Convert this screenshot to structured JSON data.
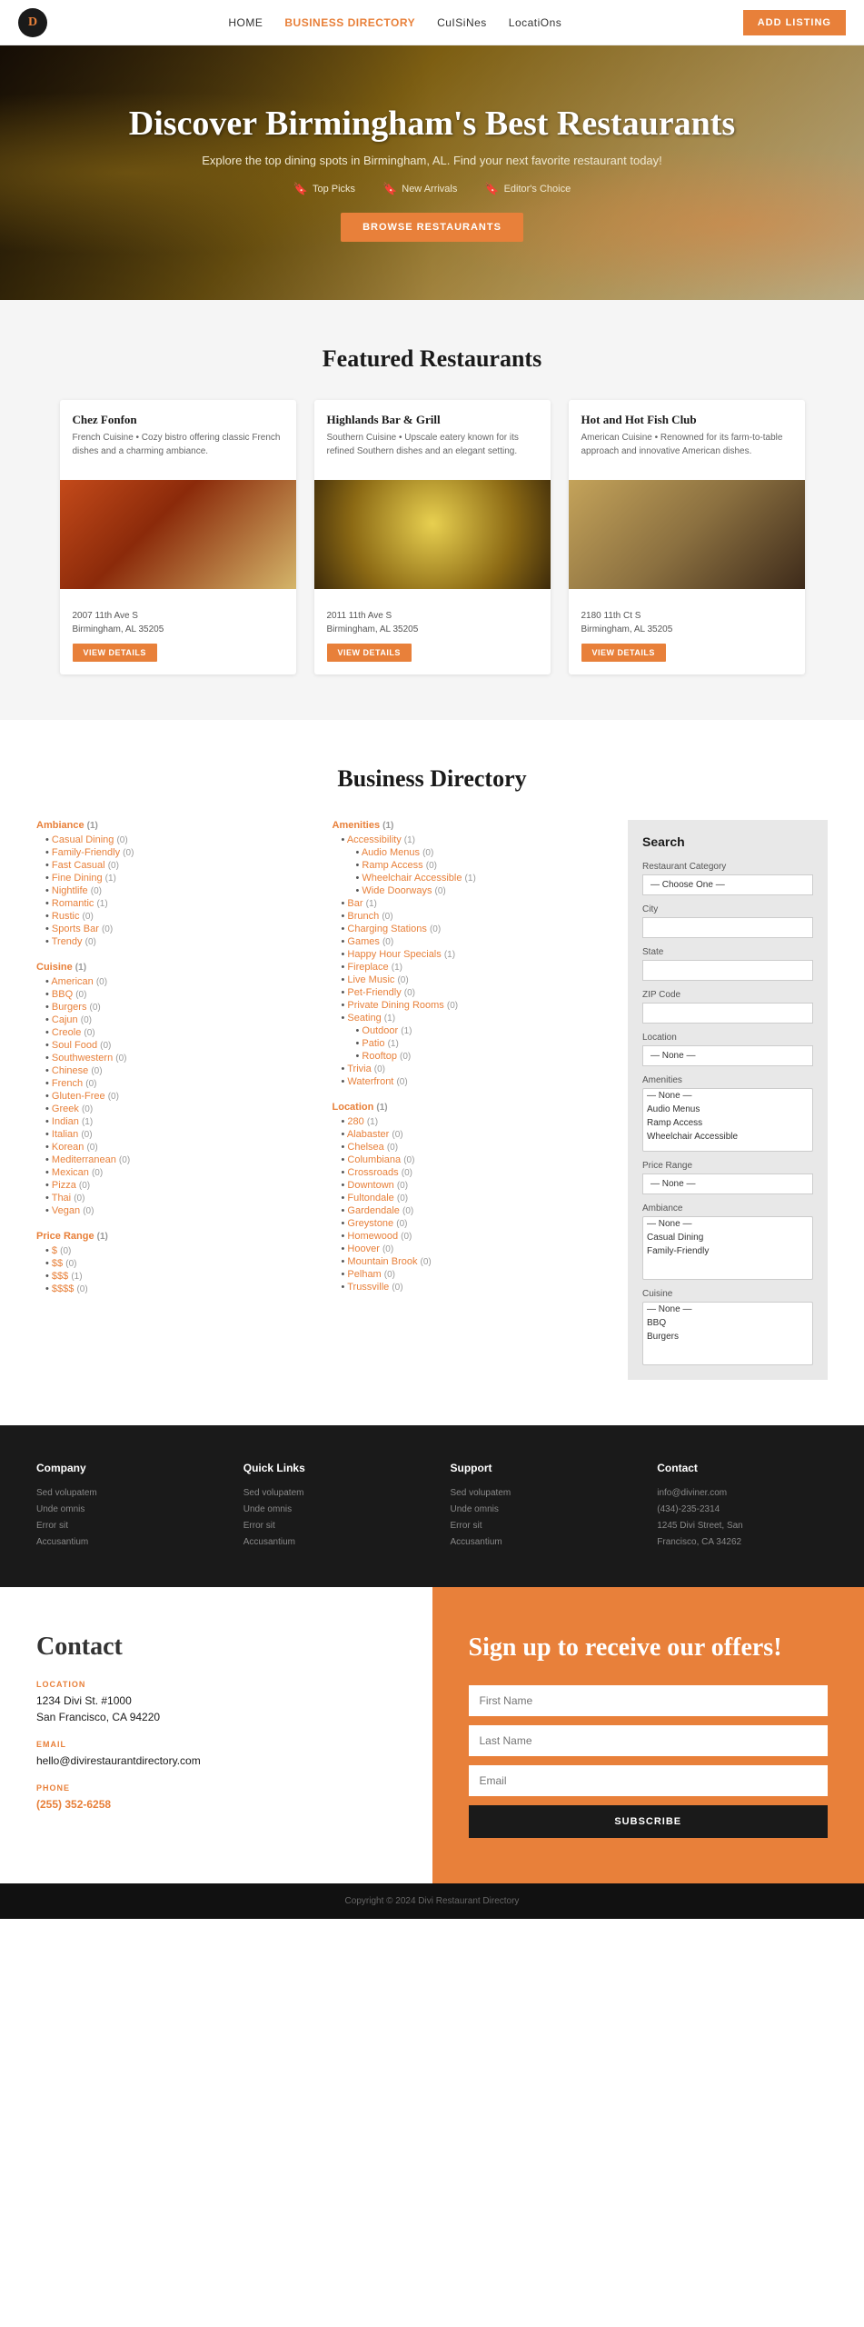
{
  "nav": {
    "logo": "D",
    "links": [
      {
        "label": "HOME",
        "active": false
      },
      {
        "label": "BUSINESS DIRECTORY",
        "active": true
      },
      {
        "label": "CuISiNes",
        "active": false
      },
      {
        "label": "LocatiOns",
        "active": false
      }
    ],
    "add_btn": "ADD LISTING"
  },
  "hero": {
    "title": "Discover Birmingham's Best Restaurants",
    "subtitle": "Explore the top dining spots in Birmingham, AL. Find your next favorite restaurant today!",
    "badges": [
      {
        "icon": "🔖",
        "label": "Top Picks"
      },
      {
        "icon": "🔖",
        "label": "New Arrivals"
      },
      {
        "icon": "🔖",
        "label": "Editor's Choice"
      }
    ],
    "browse_btn": "BROWSE RESTAURANTS"
  },
  "featured": {
    "section_title": "Featured Restaurants",
    "cards": [
      {
        "title": "Chez Fonfon",
        "desc": "French Cuisine • Cozy bistro offering classic French dishes and a charming ambiance.",
        "address": "2007 11th Ave S\nBirmingham, AL 35205",
        "btn": "VIEW DETAILS"
      },
      {
        "title": "Highlands Bar & Grill",
        "desc": "Southern Cuisine • Upscale eatery known for its refined Southern dishes and an elegant setting.",
        "address": "2011 11th Ave S\nBirmingham, AL 35205",
        "btn": "VIEW DETAILS"
      },
      {
        "title": "Hot and Hot Fish Club",
        "desc": "American Cuisine • Renowned for its farm-to-table approach and innovative American dishes.",
        "address": "2180 11th Ct S\nBirmingham, AL 35205",
        "btn": "VIEW DETAILS"
      }
    ]
  },
  "directory": {
    "section_title": "Business Directory",
    "col1": {
      "sections": [
        {
          "head": "Ambiance",
          "count": 1,
          "items": [
            {
              "label": "Casual Dining",
              "count": 0
            },
            {
              "label": "Family-Friendly",
              "count": 0
            },
            {
              "label": "Fast Casual",
              "count": 0
            },
            {
              "label": "Fine Dining",
              "count": 1
            },
            {
              "label": "Nightlife",
              "count": 0
            },
            {
              "label": "Romantic",
              "count": 1
            },
            {
              "label": "Rustic",
              "count": 0
            },
            {
              "label": "Sports Bar",
              "count": 0
            },
            {
              "label": "Trendy",
              "count": 0
            }
          ]
        },
        {
          "head": "Cuisine",
          "count": 1,
          "items": [
            {
              "label": "American",
              "count": 0
            },
            {
              "label": "BBQ",
              "count": 0
            },
            {
              "label": "Burgers",
              "count": 0
            },
            {
              "label": "Cajun",
              "count": 0
            },
            {
              "label": "Creole",
              "count": 0
            },
            {
              "label": "Soul Food",
              "count": 0
            },
            {
              "label": "Southwestern",
              "count": 0
            },
            {
              "label": "Chinese",
              "count": 0
            },
            {
              "label": "French",
              "count": 0
            },
            {
              "label": "Gluten-Free",
              "count": 0
            },
            {
              "label": "Greek",
              "count": 0
            },
            {
              "label": "Indian",
              "count": 1
            },
            {
              "label": "Italian",
              "count": 0
            },
            {
              "label": "Korean",
              "count": 0
            },
            {
              "label": "Mediterranean",
              "count": 0
            },
            {
              "label": "Mexican",
              "count": 0
            },
            {
              "label": "Pizza",
              "count": 0
            },
            {
              "label": "Thai",
              "count": 0
            },
            {
              "label": "Vegan",
              "count": 0
            }
          ]
        },
        {
          "head": "Price Range",
          "count": 1,
          "items": [
            {
              "label": "$",
              "count": 0
            },
            {
              "label": "$$",
              "count": 0
            },
            {
              "label": "$$$",
              "count": 1
            },
            {
              "label": "$$$$",
              "count": 0
            }
          ]
        }
      ]
    },
    "col2": {
      "sections": [
        {
          "head": "Amenities",
          "count": 1,
          "items": [
            {
              "label": "Accessibility",
              "count": 1,
              "subitems": [
                {
                  "label": "Audio Menus",
                  "count": 0
                },
                {
                  "label": "Ramp Access",
                  "count": 0
                },
                {
                  "label": "Wheelchair Accessible",
                  "count": 1
                },
                {
                  "label": "Wide Doorways",
                  "count": 0
                }
              ]
            },
            {
              "label": "Bar",
              "count": 1
            },
            {
              "label": "Brunch",
              "count": 0
            },
            {
              "label": "Charging Stations",
              "count": 0
            },
            {
              "label": "Games",
              "count": 0
            },
            {
              "label": "Happy Hour Specials",
              "count": 1
            },
            {
              "label": "Fireplace",
              "count": 1
            },
            {
              "label": "Live Music",
              "count": 0
            },
            {
              "label": "Pet-Friendly",
              "count": 0
            },
            {
              "label": "Private Dining Rooms",
              "count": 0
            },
            {
              "label": "Seating",
              "count": 1,
              "subitems": [
                {
                  "label": "Outdoor",
                  "count": 1
                },
                {
                  "label": "Patio",
                  "count": 1
                },
                {
                  "label": "Rooftop",
                  "count": 0
                }
              ]
            },
            {
              "label": "Trivia",
              "count": 0
            },
            {
              "label": "Waterfront",
              "count": 0
            }
          ]
        }
      ]
    },
    "col3": {
      "sections": [
        {
          "head": "Location",
          "count": 1,
          "items": [
            {
              "label": "280",
              "count": 1
            },
            {
              "label": "Alabaster",
              "count": 0
            },
            {
              "label": "Chelsea",
              "count": 0
            },
            {
              "label": "Columbiana",
              "count": 0
            },
            {
              "label": "Crossroads",
              "count": 0
            },
            {
              "label": "Downtown",
              "count": 0
            },
            {
              "label": "Fultondale",
              "count": 0
            },
            {
              "label": "Gardendale",
              "count": 0
            },
            {
              "label": "Greystone",
              "count": 0
            },
            {
              "label": "Homewood",
              "count": 0
            },
            {
              "label": "Hoover",
              "count": 0
            },
            {
              "label": "Mountain Brook",
              "count": 0
            },
            {
              "label": "Pelham",
              "count": 0
            },
            {
              "label": "Trussville",
              "count": 0
            }
          ]
        }
      ]
    }
  },
  "search": {
    "title": "Search",
    "category_label": "Restaurant Category",
    "category_placeholder": "— Choose One —",
    "city_label": "City",
    "state_label": "State",
    "zip_label": "ZIP Code",
    "location_label": "Location",
    "amenities_label": "Amenities",
    "amenities_options": [
      "— None —",
      "Audio Menus",
      "Ramp Access",
      "Wheelchair Accessible"
    ],
    "price_label": "Price Range",
    "price_placeholder": "— None —",
    "ambiance_label": "Ambiance",
    "ambiance_options": [
      "— None —",
      "Casual Dining",
      "Family-Friendly"
    ],
    "cuisine_label": "Cuisine",
    "cuisine_options": [
      "— None —",
      "BBQ",
      "Burgers"
    ]
  },
  "footer": {
    "cols": [
      {
        "title": "Company",
        "lines": [
          "Sed volupatem",
          "Unde omnis",
          "Error sit",
          "Accusantium"
        ]
      },
      {
        "title": "Quick Links",
        "lines": [
          "Sed volupatem",
          "Unde omnis",
          "Error sit",
          "Accusantium"
        ]
      },
      {
        "title": "Support",
        "lines": [
          "Sed volupatem",
          "Unde omnis",
          "Error sit",
          "Accusantium"
        ]
      },
      {
        "title": "Contact",
        "lines": [
          "info@diviner.com",
          "(434)-235-2314",
          "1245 Divi Street, San",
          "Francisco, CA 34262"
        ]
      }
    ],
    "copyright": "Copyright © 2024 Divi Restaurant Directory"
  },
  "contact": {
    "title": "Contact",
    "location_label": "LOCATION",
    "location_value": "1234 Divi St. #1000\nSan Francisco, CA 94220",
    "email_label": "EMAIL",
    "email_value": "hello@divirestaurantdirectory.com",
    "phone_label": "PHONE",
    "phone_value": "(255) 352-6258"
  },
  "signup": {
    "title": "Sign up to receive our offers!",
    "first_name_placeholder": "First Name",
    "last_name_placeholder": "Last Name",
    "email_placeholder": "Email",
    "subscribe_btn": "SUBSCRIBE"
  }
}
